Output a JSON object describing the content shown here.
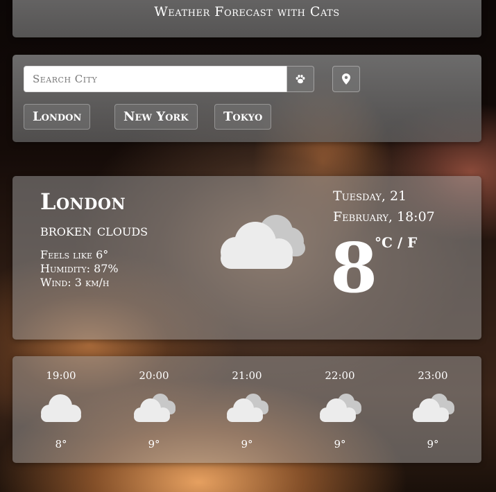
{
  "header": {
    "title": "Weather Forecast with Cats"
  },
  "search": {
    "placeholder": "Search City",
    "paw_icon": "paw-icon",
    "location_icon": "map-marker-icon"
  },
  "quick_cities": [
    "London",
    "New York",
    "Tokyo"
  ],
  "current": {
    "city": "London",
    "description": "broken clouds",
    "feels_like": "Feels like 6°",
    "humidity": "Humidity: 87%",
    "wind": "Wind: 3 km/h",
    "date_line1": "Tuesday, 21",
    "date_line2": "February, 18:07",
    "temperature": "8",
    "units": "°C / F",
    "icon": "broken-clouds-icon"
  },
  "forecast": [
    {
      "time": "19:00",
      "temp": "8°",
      "icon": "cloud-icon"
    },
    {
      "time": "20:00",
      "temp": "9°",
      "icon": "broken-clouds-icon"
    },
    {
      "time": "21:00",
      "temp": "9°",
      "icon": "broken-clouds-icon"
    },
    {
      "time": "22:00",
      "temp": "9°",
      "icon": "broken-clouds-icon"
    },
    {
      "time": "23:00",
      "temp": "9°",
      "icon": "broken-clouds-icon"
    }
  ]
}
